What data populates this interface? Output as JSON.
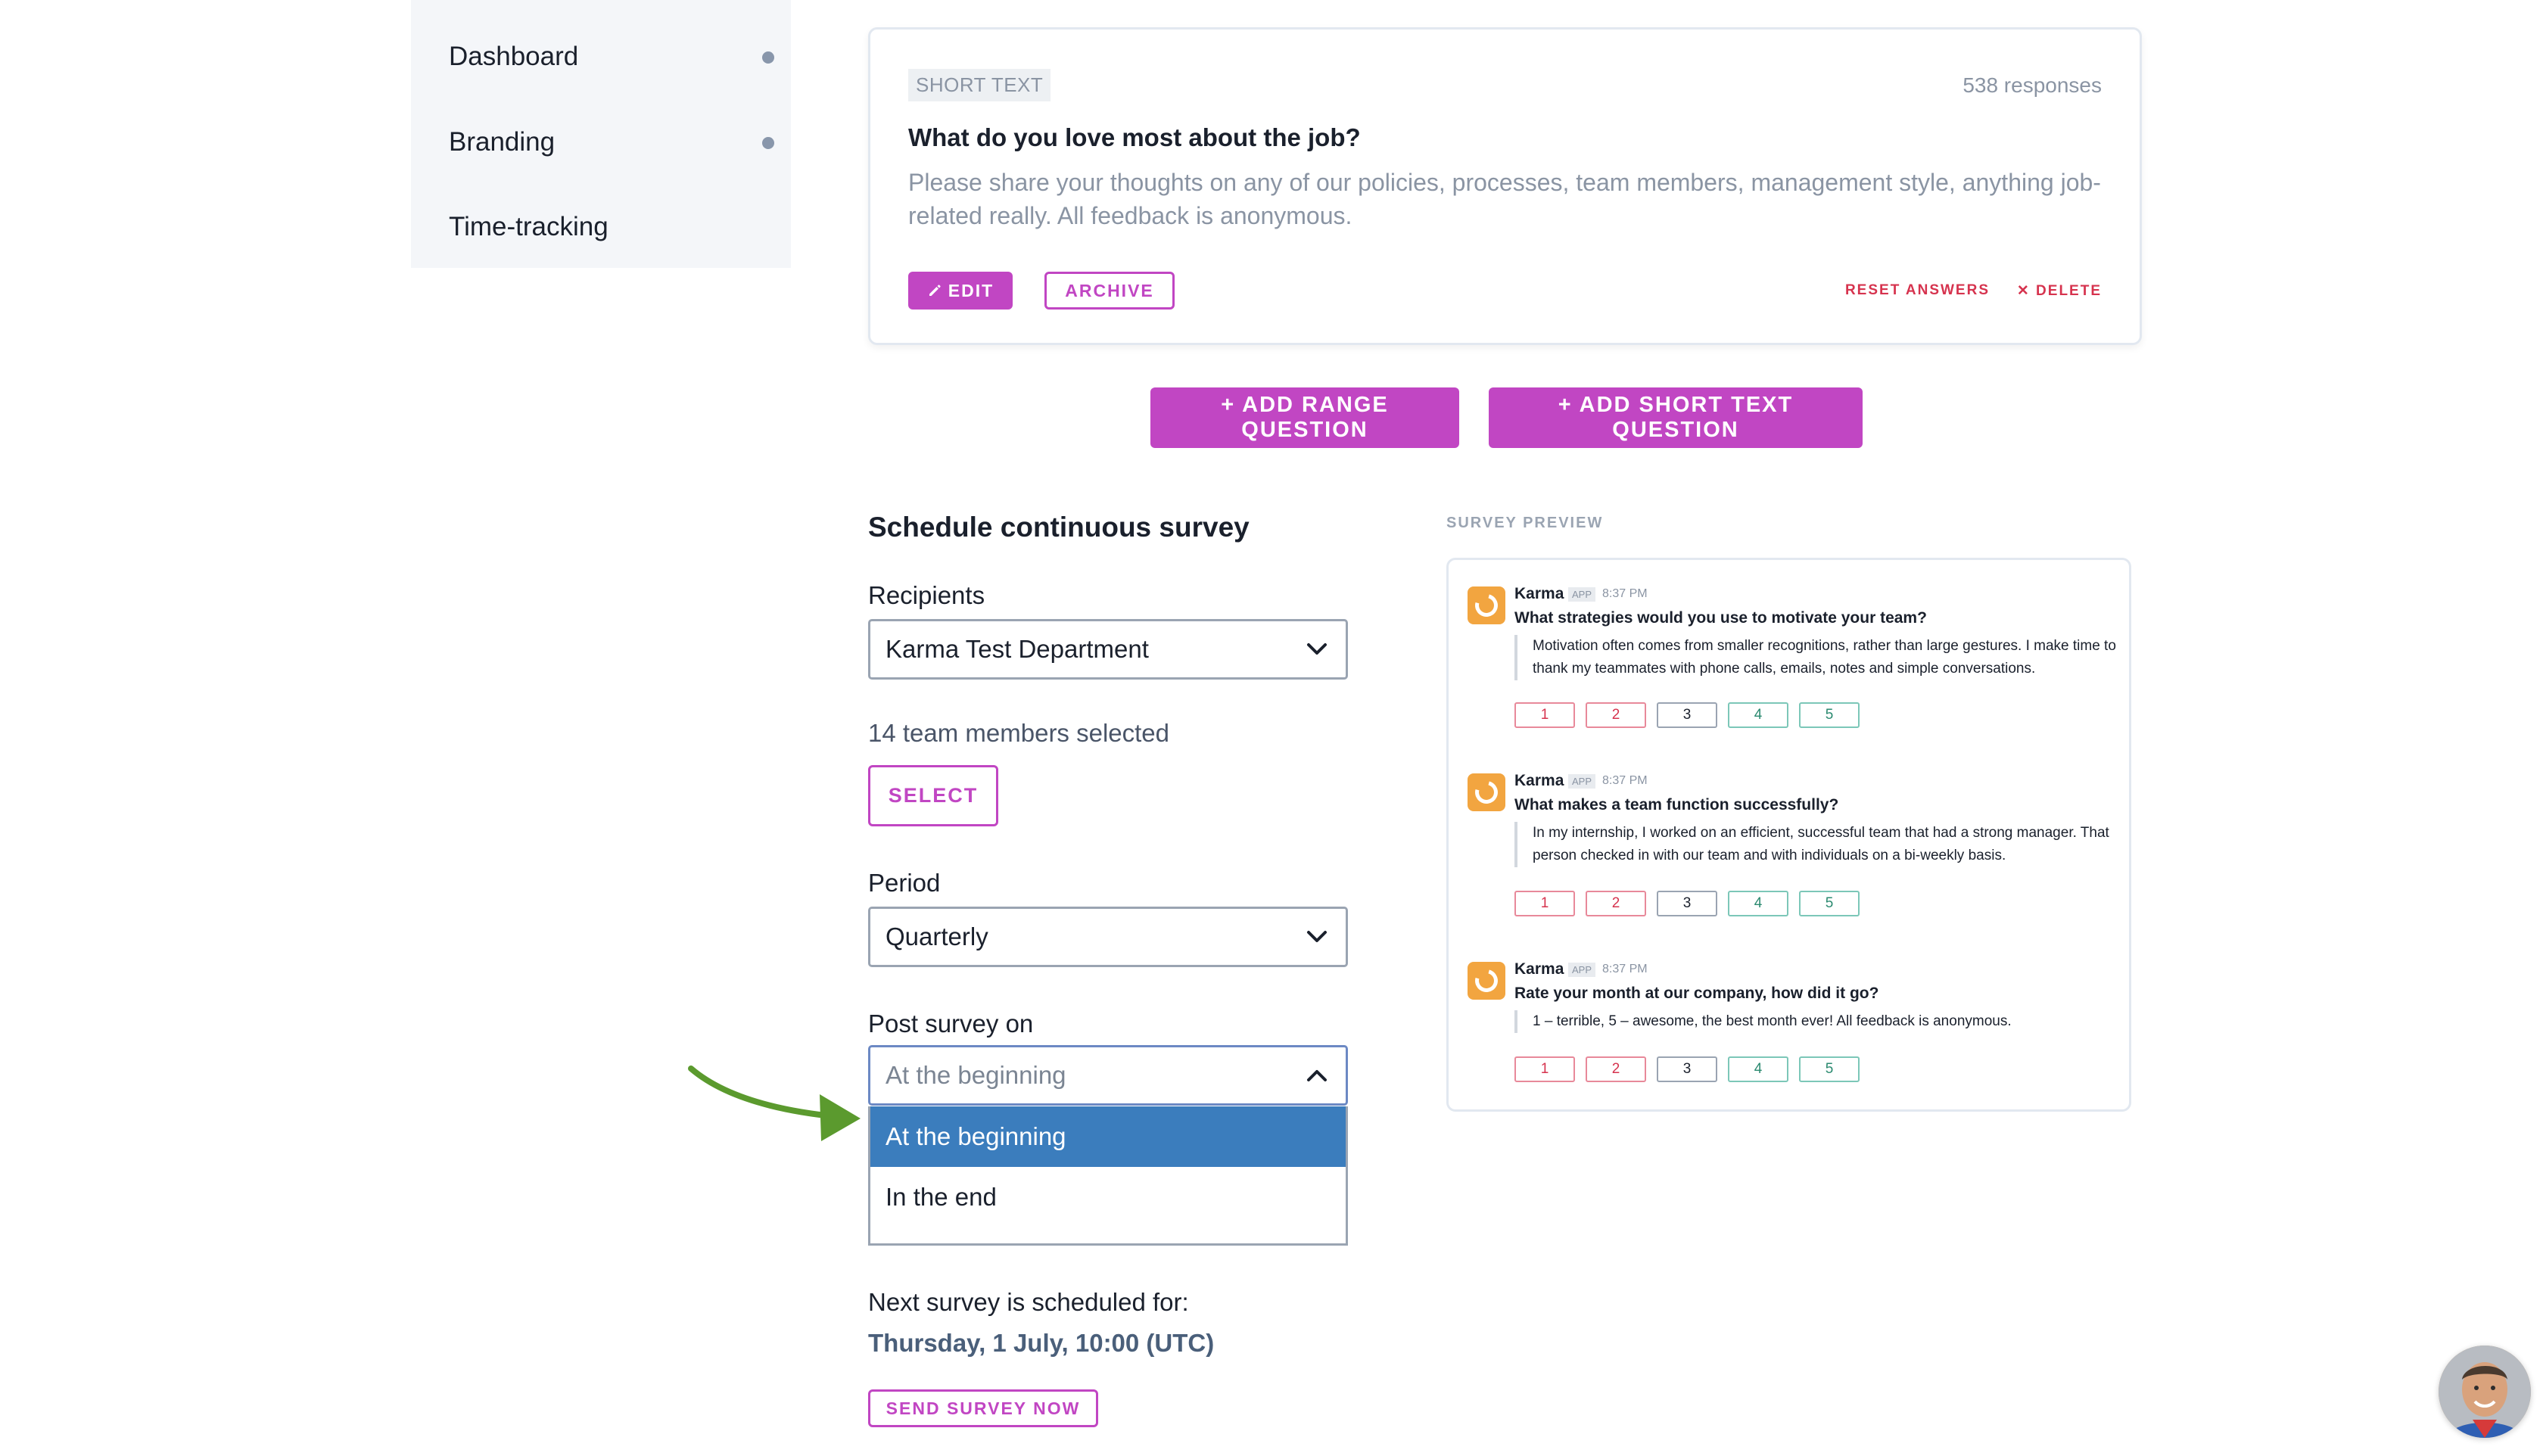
{
  "sidebar": {
    "items": [
      {
        "label": "Dashboard",
        "has_dot": true
      },
      {
        "label": "Branding",
        "has_dot": true
      },
      {
        "label": "Time-tracking",
        "has_dot": false
      }
    ]
  },
  "question_card": {
    "type_badge": "SHORT TEXT",
    "responses": "538 responses",
    "title": "What do you love most about the job?",
    "description": "Please share your thoughts on any of our policies, processes, team members, management style, anything job-related really. All feedback is anonymous.",
    "edit_label": "EDIT",
    "archive_label": "ARCHIVE",
    "reset_label": "RESET ANSWERS",
    "delete_label": "DELETE"
  },
  "add_buttons": {
    "range": "+ ADD RANGE QUESTION",
    "short_text": "+ ADD SHORT TEXT QUESTION"
  },
  "schedule": {
    "title": "Schedule continuous survey",
    "recipients_label": "Recipients",
    "recipients_value": "Karma Test Department",
    "members_selected": "14 team members selected",
    "select_label": "SELECT",
    "period_label": "Period",
    "period_value": "Quarterly",
    "post_label": "Post survey on",
    "post_value": "At the beginning",
    "post_options": [
      "At the beginning",
      "In the end"
    ],
    "next_label": "Next survey is scheduled for:",
    "next_date": "Thursday, 1 July, 10:00 (UTC)",
    "send_now_label": "SEND SURVEY NOW"
  },
  "preview": {
    "label": "SURVEY PREVIEW",
    "messages": [
      {
        "name": "Karma",
        "app": "APP",
        "time": "8:37 PM",
        "question": "What strategies would you use to motivate your team?",
        "quote": "Motivation often comes from smaller recognitions, rather than large gestures. I make time to thank my teammates with phone calls, emails, notes and simple conversations.",
        "ratings": [
          "1",
          "2",
          "3",
          "4",
          "5"
        ]
      },
      {
        "name": "Karma",
        "app": "APP",
        "time": "8:37 PM",
        "question": "What makes a team function successfully?",
        "quote": "In my internship, I worked on an efficient, successful team that had a strong manager. That person checked in with our team and with individuals on a bi-weekly basis.",
        "ratings": [
          "1",
          "2",
          "3",
          "4",
          "5"
        ]
      },
      {
        "name": "Karma",
        "app": "APP",
        "time": "8:37 PM",
        "question": "Rate your month at our company, how did it go?",
        "quote": "1 – terrible, 5 – awesome, the best month ever! All feedback is anonymous.",
        "ratings": [
          "1",
          "2",
          "3",
          "4",
          "5"
        ]
      }
    ]
  },
  "colors": {
    "accent": "#c146c3",
    "danger": "#d6334e",
    "selected_option": "#3b7dbd",
    "annotation_arrow": "#5b9a2e"
  }
}
